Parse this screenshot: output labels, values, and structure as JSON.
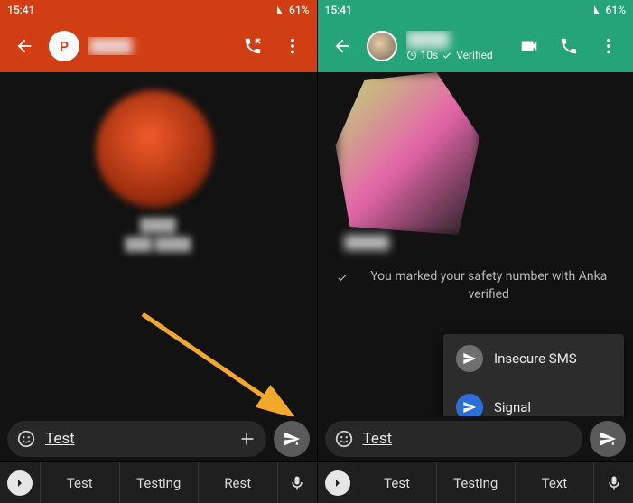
{
  "status": {
    "time": "15:41",
    "battery": "61%"
  },
  "left": {
    "avatar_letter": "P",
    "contact_name": "████",
    "input_text": "Test",
    "suggestions": [
      "Test",
      "Testing",
      "Rest"
    ]
  },
  "right": {
    "contact_name": "████",
    "disappearing": "10s",
    "verified_label": "Verified",
    "safety_msg": "You marked your safety number with Anka verified",
    "menu": {
      "item1": "Insecure SMS",
      "item2": "Signal"
    },
    "input_text": "Test",
    "suggestions": [
      "Test",
      "Testing",
      "Text"
    ]
  }
}
